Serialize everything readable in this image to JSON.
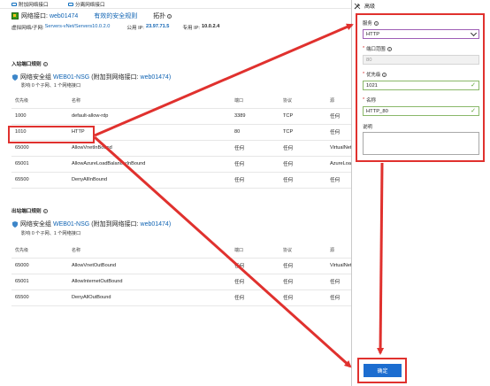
{
  "toolbar": {
    "attach": "附加网络接口",
    "detach": "分离网络接口"
  },
  "header": {
    "title_prefix": "网络接口:",
    "nic_name": "web01474",
    "effective_rules": "有效的安全规则",
    "topology": "拓扑",
    "vnet_label": "虚拟网络/子网:",
    "vnet_value": "Servers-vNet/Servers10.0.2.0",
    "public_ip_label": "公用 IP:",
    "public_ip": "23.97.71.5",
    "private_ip_label": "专用 IP:",
    "private_ip": "10.0.2.4"
  },
  "inbound": {
    "section_title": "入站端口规则",
    "nsg_label": "网络安全组",
    "nsg_name": "WEB01-NSG",
    "nsg_attach": "(附加到网络接口:",
    "nsg_nic": "web01474)",
    "impacts": "影响 0 个子网、1 个网络接口",
    "columns": [
      "优先级",
      "名称",
      "端口",
      "协议",
      "源"
    ],
    "rows": [
      [
        "1000",
        "default-allow-rdp",
        "3389",
        "TCP",
        "任何"
      ],
      [
        "1010",
        "HTTP",
        "80",
        "TCP",
        "任何"
      ],
      [
        "65000",
        "AllowVnetInBound",
        "任何",
        "任何",
        "VirtualNetwork"
      ],
      [
        "65001",
        "AllowAzureLoadBalancerInBound",
        "任何",
        "任何",
        "AzureLoadBalancer"
      ],
      [
        "65500",
        "DenyAllInBound",
        "任何",
        "任何",
        "任何"
      ]
    ]
  },
  "outbound": {
    "section_title": "出站端口规则",
    "nsg_label": "网络安全组",
    "nsg_name": "WEB01-NSG",
    "nsg_attach": "(附加到网络接口:",
    "nsg_nic": "web01474)",
    "impacts": "影响 0 个子网、1 个网络接口",
    "columns": [
      "优先级",
      "名称",
      "端口",
      "协议",
      "源"
    ],
    "rows": [
      [
        "65000",
        "AllowVnetOutBound",
        "任何",
        "任何",
        "VirtualNetwork"
      ],
      [
        "65001",
        "AllowInternetOutBound",
        "任何",
        "任何",
        "任何"
      ],
      [
        "65500",
        "DenyAllOutBound",
        "任何",
        "任何",
        "任何"
      ]
    ]
  },
  "panel": {
    "title": "高级",
    "service_label": "服务",
    "service_value": "HTTP",
    "port_label": "端口范围",
    "port_value": "80",
    "priority_label": "优先级",
    "priority_value": "1021",
    "name_label": "名称",
    "name_value": "HTTP_80",
    "desc_label": "说明",
    "ok_label": "确定"
  },
  "colors": {
    "accent": "#0f63b3",
    "highlight": "#e0312e",
    "button": "#1c6dd0"
  }
}
